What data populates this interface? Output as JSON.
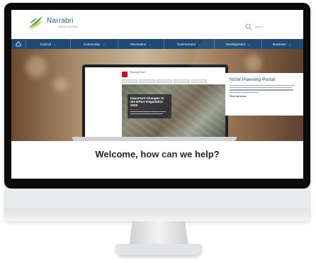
{
  "site": {
    "logo_title": "Narrabri",
    "logo_subtitle": "SHIRE COUNCIL",
    "search_label": "Search"
  },
  "nav": {
    "items": [
      {
        "label": "Council"
      },
      {
        "label": "Community"
      },
      {
        "label": "Recreation"
      },
      {
        "label": "Environment"
      },
      {
        "label": "Development"
      },
      {
        "label": "Business"
      }
    ]
  },
  "hero": {
    "laptop_brand": "Planning Portal",
    "laptop_card_title": "Important Changes to the EP&A Regulation 2000",
    "panel_title": "NSW Planning Portal",
    "panel_link": "Find out more"
  },
  "welcome": "Welcome, how can we help?",
  "colors": {
    "nav_bg": "#1f4a73",
    "accent_red": "#c8102e",
    "logo_green": "#6ab04c",
    "logo_yellow": "#f2c12e"
  }
}
